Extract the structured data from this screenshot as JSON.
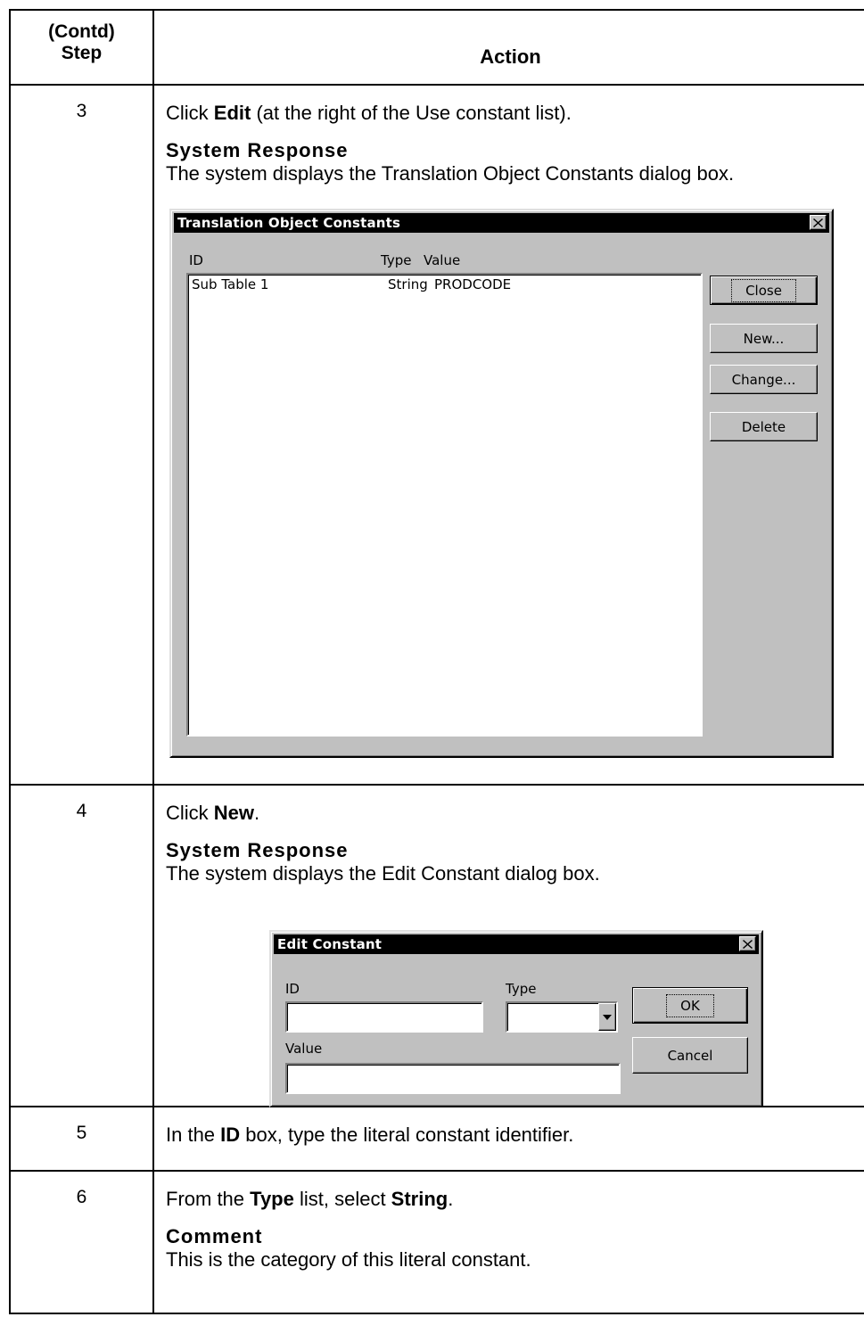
{
  "table": {
    "header": {
      "step_line1": "(Contd)",
      "step_line2": "Step",
      "action": "Action"
    },
    "rows": [
      {
        "step": "3",
        "instruction": {
          "pre": "Click ",
          "bold": "Edit",
          "post": " (at the right of the Use constant list)."
        },
        "response_heading": "System Response",
        "response_text": "The system displays the Translation Object Constants dialog box."
      },
      {
        "step": "4",
        "instruction": {
          "pre": "Click ",
          "bold": "New",
          "post": "."
        },
        "response_heading": "System Response",
        "response_text": "The system displays the Edit Constant dialog box."
      },
      {
        "step": "5",
        "instruction": {
          "pre": "In the ",
          "bold": "ID",
          "post": " box, type the literal constant identifier."
        }
      },
      {
        "step": "6",
        "instruction": {
          "pre": "From the ",
          "bold": "Type",
          "mid": " list, select ",
          "bold2": "String",
          "post": "."
        },
        "response_heading": "Comment",
        "response_text": "This is the category of this literal constant."
      }
    ]
  },
  "dialog_constants": {
    "title": "Translation Object Constants",
    "columns": {
      "id": "ID",
      "type": "Type",
      "value": "Value"
    },
    "rows": [
      {
        "id": "Sub Table 1",
        "type": "String",
        "value": "PRODCODE"
      }
    ],
    "buttons": {
      "close": "Close",
      "new": "New...",
      "change": "Change...",
      "delete": "Delete"
    }
  },
  "dialog_edit": {
    "title": "Edit Constant",
    "id_label": "ID",
    "type_label": "Type",
    "value_label": "Value",
    "id_value": "",
    "type_value": "",
    "value_value": "",
    "buttons": {
      "ok": "OK",
      "cancel": "Cancel"
    }
  }
}
